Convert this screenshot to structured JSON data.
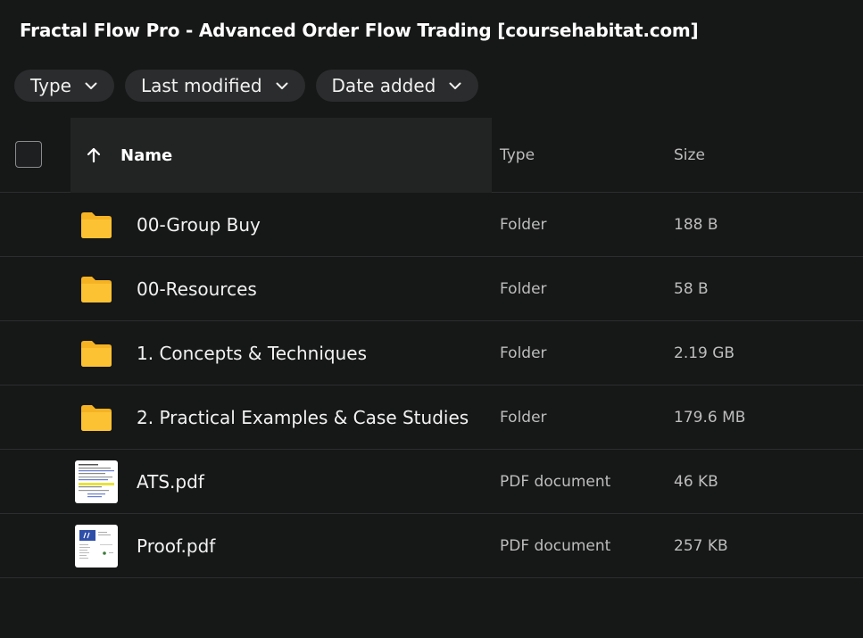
{
  "page": {
    "title": "Fractal Flow Pro - Advanced Order Flow Trading [coursehabitat.com]"
  },
  "filters": [
    {
      "label": "Type",
      "icon": "chevron-down-icon"
    },
    {
      "label": "Last modified",
      "icon": "chevron-down-icon"
    },
    {
      "label": "Date added",
      "icon": "chevron-down-icon"
    }
  ],
  "table": {
    "headers": {
      "name": "Name",
      "type": "Type",
      "size": "Size",
      "sort_icon": "arrow-up-icon"
    },
    "rows": [
      {
        "name": "00-Group Buy",
        "type": "Folder",
        "size": "188 B",
        "icon": "folder-icon"
      },
      {
        "name": "00-Resources",
        "type": "Folder",
        "size": "58 B",
        "icon": "folder-icon"
      },
      {
        "name": "1. Concepts & Techniques",
        "type": "Folder",
        "size": "2.19 GB",
        "icon": "folder-icon"
      },
      {
        "name": "2. Practical Examples & Case Studies",
        "type": "Folder",
        "size": "179.6 MB",
        "icon": "folder-icon"
      },
      {
        "name": "ATS.pdf",
        "type": "PDF document",
        "size": "46 KB",
        "icon": "pdf-thumbnail"
      },
      {
        "name": "Proof.pdf",
        "type": "PDF document",
        "size": "257 KB",
        "icon": "pdf-thumbnail"
      }
    ]
  },
  "colors": {
    "background": "#161717",
    "chip": "#2b2c2d",
    "folder": "#f5b324",
    "divider": "#2c2d2e"
  }
}
